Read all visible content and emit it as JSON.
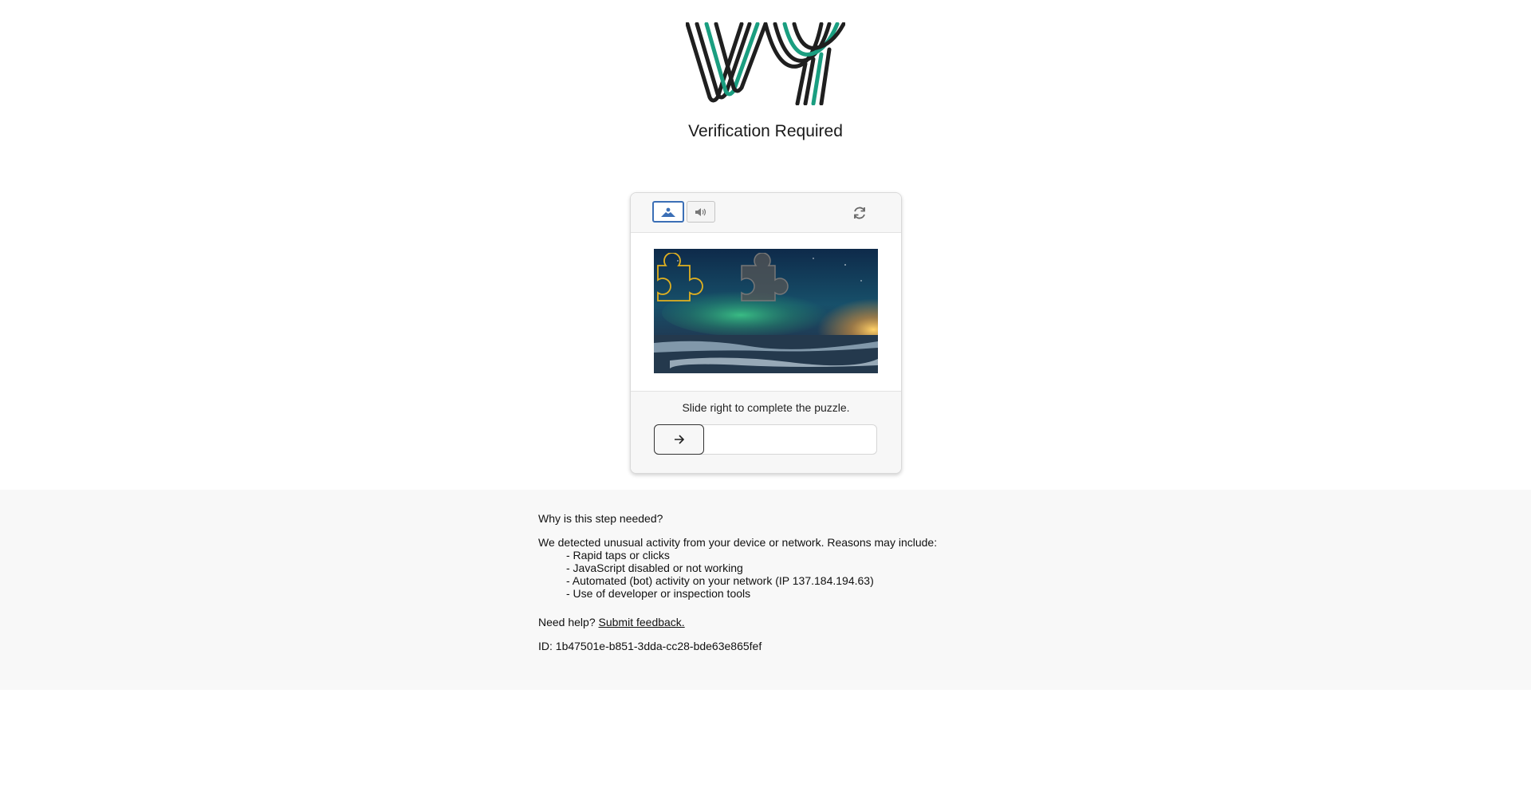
{
  "header": {
    "logo_icon": "vy-logo-icon",
    "title": "Verification Required"
  },
  "captcha": {
    "modes": [
      {
        "icon": "image-icon",
        "selected": true
      },
      {
        "icon": "audio-icon",
        "selected": false
      }
    ],
    "refresh_icon": "refresh-icon",
    "image_description_icon": "puzzle-piece-icon",
    "instruction": "Slide right to complete the puzzle.",
    "slider_icon": "arrow-right-icon",
    "slider_progress": 0
  },
  "info": {
    "question": "Why is this step needed?",
    "intro": "We detected unusual activity from your device or network. Reasons may include:",
    "reasons": [
      "- Rapid taps or clicks",
      "- JavaScript disabled or not working",
      "- Automated (bot) activity on your network (IP 137.184.194.63)",
      "- Use of developer or inspection tools"
    ],
    "help_prefix": "Need help?",
    "help_link": "Submit feedback.",
    "id_text": "ID: 1b47501e-b851-3dda-cc28-bde63e865fef"
  },
  "colors": {
    "accent_blue": "#3b6fb6",
    "logo_teal": "#1a9e80",
    "logo_dark": "#1f1f1f",
    "piece_outline": "#e0b020"
  }
}
